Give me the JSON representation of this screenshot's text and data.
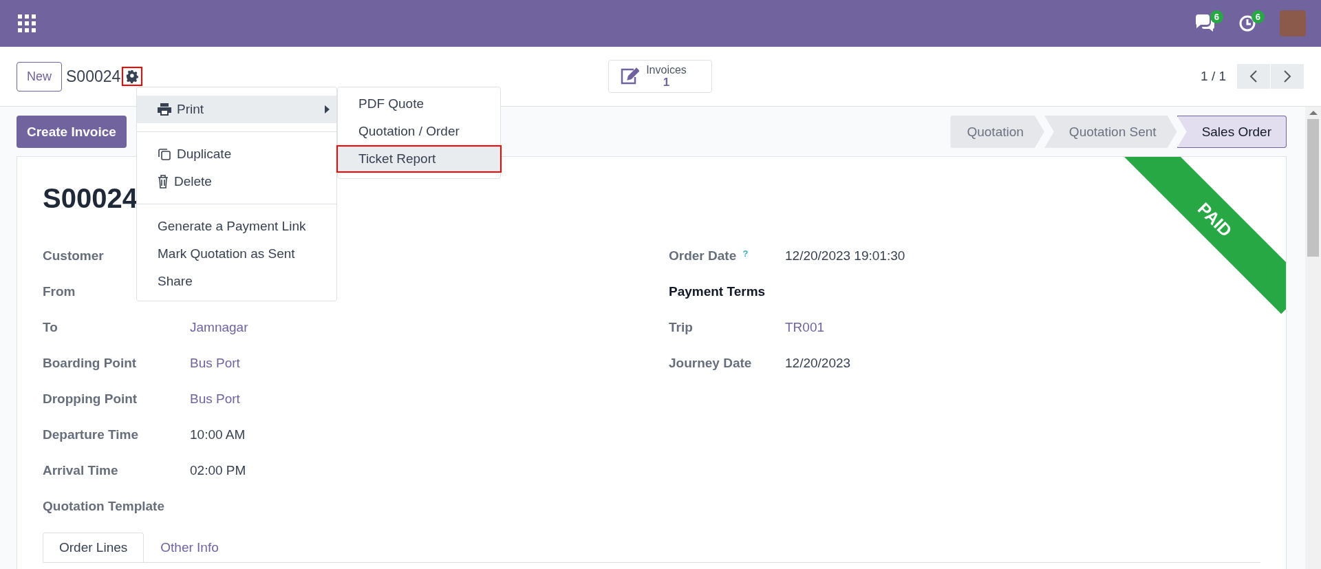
{
  "navbar": {
    "messages_count": "6",
    "activities_count": "6"
  },
  "control_panel": {
    "new_button": "New",
    "record_name": "S00024",
    "gear_highlighted": true,
    "smart_button": {
      "label": "Invoices",
      "count": "1"
    },
    "pager": "1 / 1"
  },
  "action_menu": {
    "groups": [
      [
        {
          "kind": "submenu",
          "label": "Print",
          "selected": true
        }
      ],
      [
        {
          "kind": "duplicate",
          "label": "Duplicate",
          "selected": false
        },
        {
          "kind": "delete",
          "label": "Delete",
          "selected": false
        }
      ],
      [
        {
          "kind": "plain",
          "label": "Generate a Payment Link",
          "selected": false
        },
        {
          "kind": "plain",
          "label": "Mark Quotation as Sent",
          "selected": false
        },
        {
          "kind": "plain",
          "label": "Share",
          "selected": false
        }
      ]
    ],
    "submenu": [
      {
        "label": "PDF Quote",
        "selected": false,
        "highlighted": false
      },
      {
        "label": "Quotation / Order",
        "selected": false,
        "highlighted": false
      },
      {
        "label": "Ticket Report",
        "selected": true,
        "highlighted": true
      }
    ]
  },
  "buttons": [
    "Create Invoice"
  ],
  "statusbar": [
    {
      "label": "Quotation",
      "selected": false
    },
    {
      "label": "Quotation Sent",
      "selected": false
    },
    {
      "label": "Sales Order",
      "selected": true
    }
  ],
  "ribbon": "PAID",
  "title": "S00024",
  "left_fields": [
    {
      "label": "Customer"
    },
    {
      "label": "From"
    },
    {
      "label": "To",
      "value": "Jamnagar",
      "kind": "link"
    },
    {
      "label": "Boarding Point",
      "value": "Bus Port",
      "kind": "link"
    },
    {
      "label": "Dropping Point",
      "value": "Bus Port",
      "kind": "link"
    },
    {
      "label": "Departure Time",
      "value": "10:00 AM",
      "kind": "text"
    },
    {
      "label": "Arrival Time",
      "value": "02:00 PM",
      "kind": "text"
    },
    {
      "label": "Quotation Template"
    }
  ],
  "right_fields": [
    {
      "label": "Order Date",
      "help": "?",
      "value": "12/20/2023 19:01:30",
      "kind": "text"
    },
    {
      "label": "Payment Terms",
      "kind": "section"
    },
    {
      "label": "Trip",
      "value": "TR001",
      "kind": "link"
    },
    {
      "label": "Journey Date",
      "value": "12/20/2023",
      "kind": "text"
    }
  ],
  "tabs": [
    {
      "label": "Order Lines",
      "selected": true
    },
    {
      "label": "Other Info",
      "selected": false
    }
  ]
}
